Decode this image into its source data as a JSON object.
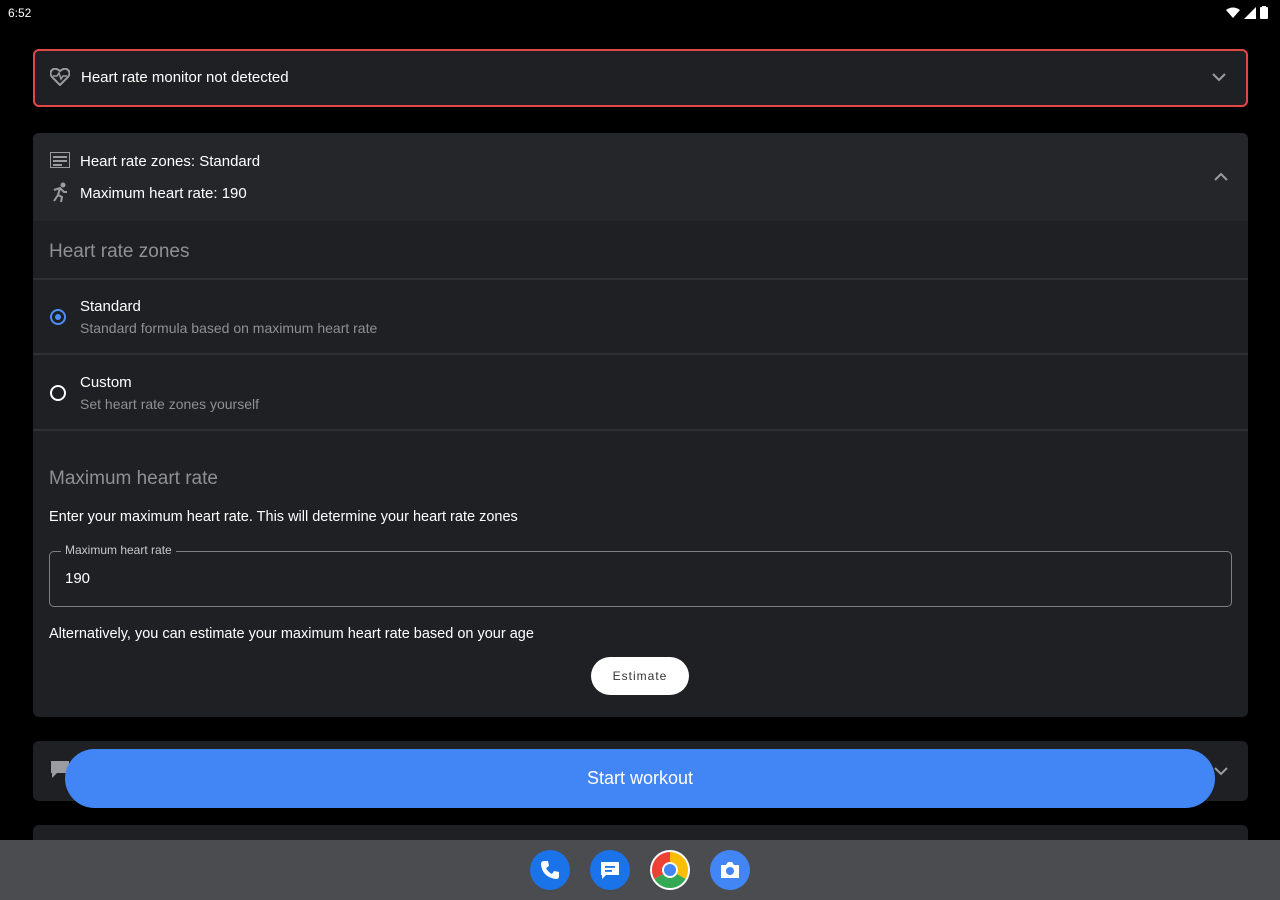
{
  "status_bar": {
    "time": "6:52"
  },
  "hr_monitor": {
    "label": "Heart rate monitor not detected",
    "accent_color": "#e04848"
  },
  "zones_summary": {
    "zones_line": "Heart rate zones: Standard",
    "max_line": "Maximum heart rate: 190"
  },
  "zones_section": {
    "title": "Heart rate zones",
    "options": [
      {
        "title": "Standard",
        "subtitle": "Standard formula based on maximum heart rate",
        "selected": true
      },
      {
        "title": "Custom",
        "subtitle": "Set heart rate zones yourself",
        "selected": false
      }
    ]
  },
  "max_section": {
    "title": "Maximum heart rate",
    "description": "Enter your maximum heart rate. This will determine your heart rate zones",
    "field_label": "Maximum heart rate",
    "field_value": "190",
    "alt_text": "Alternatively, you can estimate your maximum heart rate based on your age",
    "estimate_label": "Estimate"
  },
  "start_button": {
    "label": "Start workout",
    "color": "#4285f4"
  },
  "dock": {
    "apps": [
      "phone-icon",
      "messages-icon",
      "chrome-icon",
      "camera-icon"
    ]
  }
}
